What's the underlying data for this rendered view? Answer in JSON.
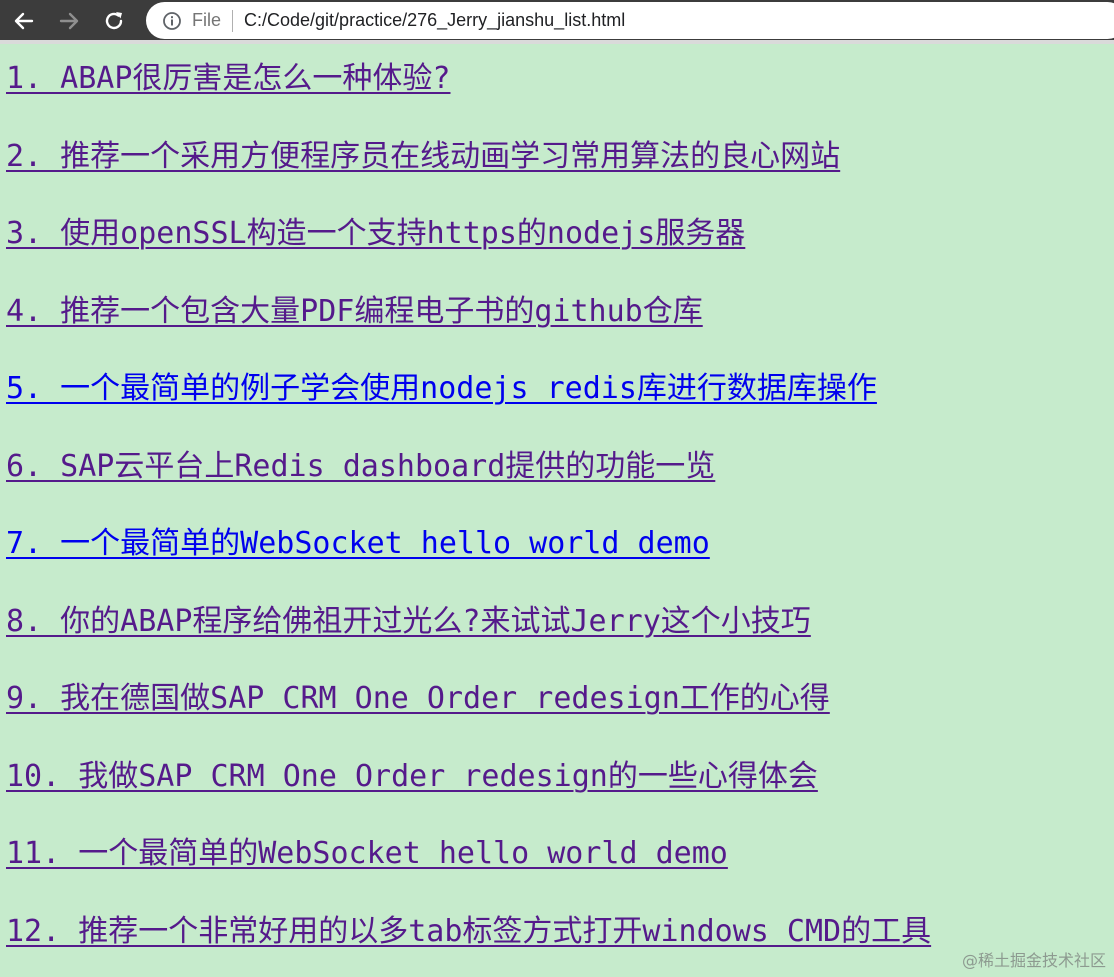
{
  "browser": {
    "scheme_label": "File",
    "url": "C:/Code/git/practice/276_Jerry_jianshu_list.html"
  },
  "links": [
    {
      "text": "1. ABAP很厉害是怎么一种体验? ",
      "visited": true
    },
    {
      "text": "2. 推荐一个采用方便程序员在线动画学习常用算法的良心网站",
      "visited": true
    },
    {
      "text": "3. 使用openSSL构造一个支持https的nodejs服务器",
      "visited": true
    },
    {
      "text": "4. 推荐一个包含大量PDF编程电子书的github仓库",
      "visited": true
    },
    {
      "text": "5. 一个最简单的例子学会使用nodejs redis库进行数据库操作",
      "visited": false
    },
    {
      "text": "6. SAP云平台上Redis dashboard提供的功能一览",
      "visited": true
    },
    {
      "text": "7. 一个最简单的WebSocket hello world demo",
      "visited": false
    },
    {
      "text": "8. 你的ABAP程序给佛祖开过光么?来试试Jerry这个小技巧",
      "visited": true
    },
    {
      "text": "9. 我在德国做SAP CRM One Order redesign工作的心得",
      "visited": true
    },
    {
      "text": "10. 我做SAP CRM One Order redesign的一些心得体会",
      "visited": true
    },
    {
      "text": "11. 一个最简单的WebSocket hello world demo",
      "visited": true
    },
    {
      "text": "12. 推荐一个非常好用的以多tab标签方式打开windows CMD的工具",
      "visited": true
    }
  ],
  "watermark": "@稀土掘金技术社区"
}
